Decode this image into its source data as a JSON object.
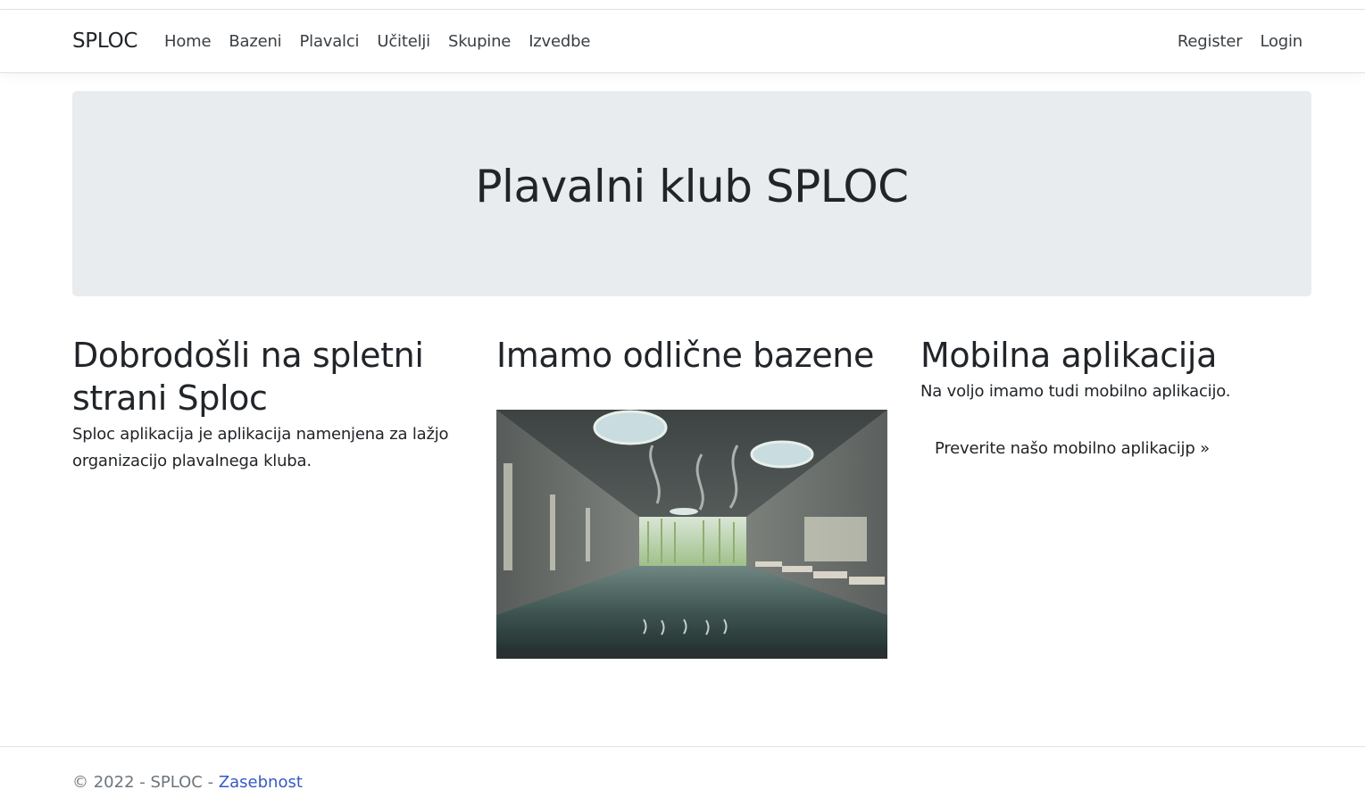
{
  "navbar": {
    "brand": "SPLOC",
    "left_items": [
      {
        "label": "Home"
      },
      {
        "label": "Bazeni"
      },
      {
        "label": "Plavalci"
      },
      {
        "label": "Učitelji"
      },
      {
        "label": "Skupine"
      },
      {
        "label": "Izvedbe"
      }
    ],
    "right_items": [
      {
        "label": "Register"
      },
      {
        "label": "Login"
      }
    ]
  },
  "hero": {
    "title": "Plavalni klub SPLOC"
  },
  "columns": {
    "welcome": {
      "heading": "Dobrodošli na spletni strani Sploc",
      "text": "Sploc aplikacija je aplikacija namenjena za lažjo organizacijo plavalnega kluba."
    },
    "pools": {
      "heading": "Imamo odlične bazene"
    },
    "mobile": {
      "heading": "Mobilna aplikacija",
      "text": "Na voljo imamo tudi mobilno aplikacijo.",
      "button_label": "Preverite našo mobilno aplikacijp »"
    }
  },
  "footer": {
    "copyright": "© 2022 - SPLOC - ",
    "privacy_link": "Zasebnost"
  },
  "colors": {
    "hero_bg": "#e9ecef",
    "link": "#3559c7",
    "footer_text": "#6c757d"
  }
}
